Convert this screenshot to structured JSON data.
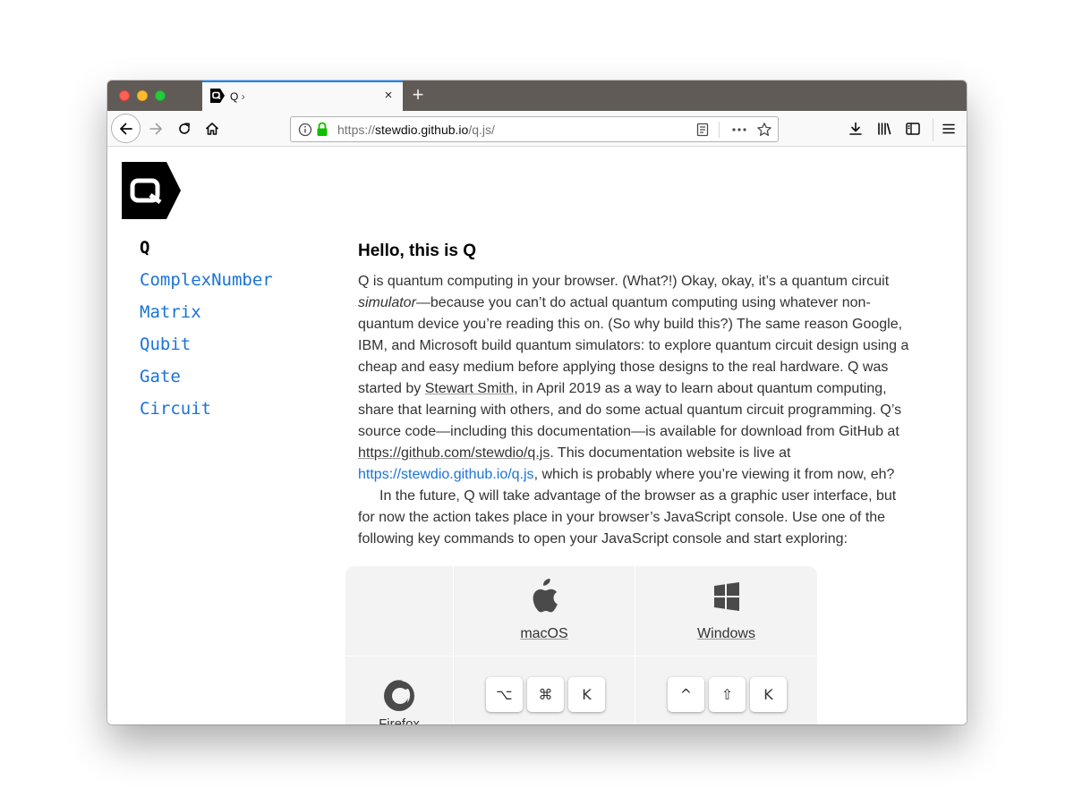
{
  "browser": {
    "tab": {
      "title": "Q",
      "chevron": "›",
      "close": "×"
    },
    "new_tab": "+",
    "url": {
      "prefix": "https://",
      "host": "stewdio.github.io",
      "path": "/q.js/"
    }
  },
  "colors": {
    "tab_accent": "#0a84ff",
    "link": "#1a73d9",
    "tabbar_bg": "#615b57",
    "secure_lock": "#12bc00"
  },
  "sidebar": {
    "items": [
      {
        "label": "Q",
        "current": true
      },
      {
        "label": "ComplexNumber"
      },
      {
        "label": "Matrix"
      },
      {
        "label": "Qubit"
      },
      {
        "label": "Gate"
      },
      {
        "label": "Circuit"
      }
    ]
  },
  "article": {
    "heading": "Hello, this is Q",
    "p1": {
      "t1": "Q is quantum computing in your browser. (What?!) Okay, okay, it’s a quantum circuit ",
      "em": "simulator",
      "t2": "—because you can’t do actual quantum computing using whatever non-quantum device you’re reading this on. (So why build this?) The same reason Google, IBM, and Microsoft build quantum simulators: to explore quantum circuit design using a cheap and easy medium before applying those designs to the real hardware. Q was started by ",
      "link1": "Stewart Smith",
      "t3": ", in April 2019 as a way to learn about quantum computing, share that learning with others, and do some actual quantum circuit programming. Q’s source code—including this documentation—is available for download from GitHub at ",
      "link2": "https://github.com/stewdio/q.js",
      "t4": ". This documentation website is live at ",
      "link3": "https://stewdio.github.io/q.js",
      "t5": ", which is probably where you’re viewing it from now, eh?"
    },
    "p2": "In the future, Q will take advantage of the browser as a graphic user interface, but for now the action takes place in your browser’s JavaScript console. Use one of the following key commands to open your JavaScript console and start exploring:"
  },
  "key_table": {
    "os": [
      {
        "label": "macOS",
        "icon": "apple-icon"
      },
      {
        "label": "Windows",
        "icon": "windows-icon"
      }
    ],
    "browser": {
      "label": "Firefox",
      "icon": "firefox-icon"
    },
    "mac_keys": [
      "⌥",
      "⌘",
      "K"
    ],
    "win_keys": [
      "^",
      "⇧",
      "K"
    ]
  }
}
